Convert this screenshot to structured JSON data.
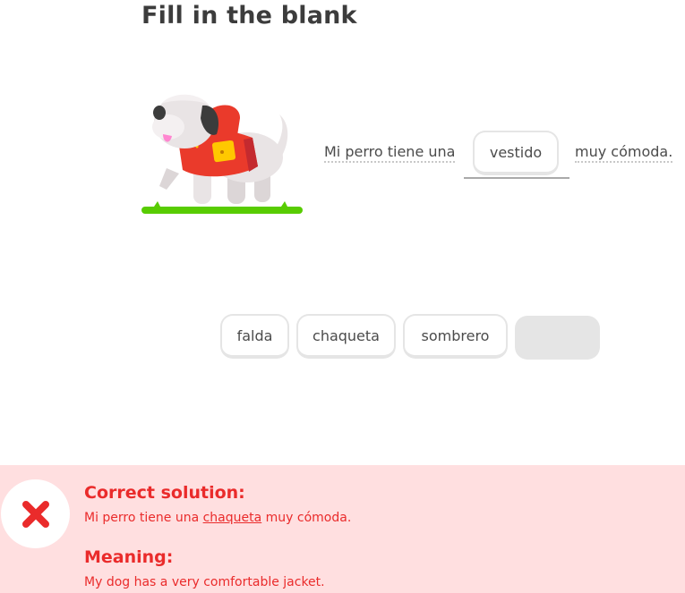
{
  "header": {
    "title": "Fill in the blank"
  },
  "sentence": {
    "before": "Mi perro tiene una",
    "answer": "vestido",
    "after": "muy cómoda."
  },
  "word_bank": [
    {
      "label": "falda"
    },
    {
      "label": "chaqueta"
    },
    {
      "label": "sombrero"
    },
    {
      "label": ""
    }
  ],
  "feedback": {
    "correct_heading": "Correct solution:",
    "solution_before": "Mi perro tiene una",
    "solution_word": "chaqueta",
    "solution_after": "muy cómoda.",
    "meaning_heading": "Meaning:",
    "meaning_text": "My dog has a very comfortable jacket.",
    "status_icon": "x-icon",
    "colors": {
      "panel_bg": "#ffdfe0",
      "accent": "#ea2b2b"
    }
  }
}
